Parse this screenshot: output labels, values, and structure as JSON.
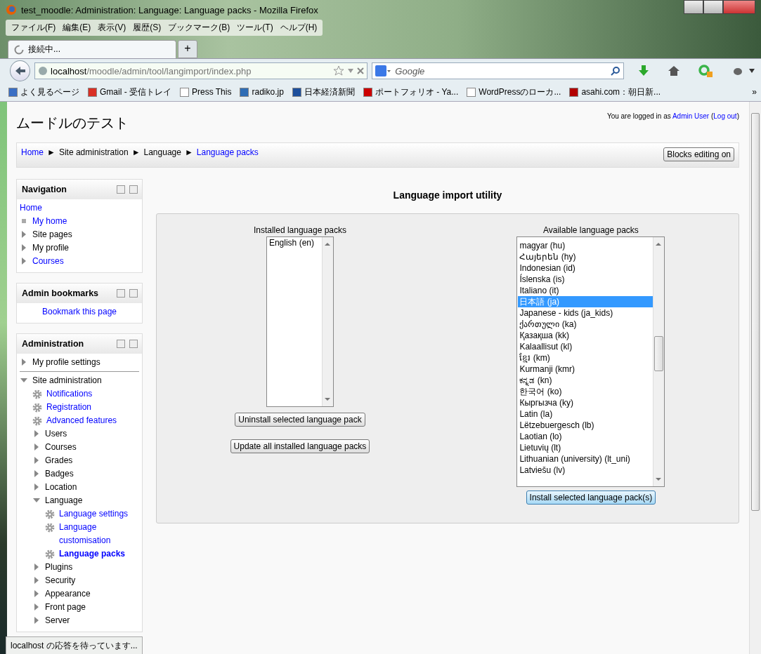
{
  "window": {
    "title": "test_moodle: Administration: Language: Language packs - Mozilla Firefox"
  },
  "menu": [
    "ファイル(F)",
    "編集(E)",
    "表示(V)",
    "履歴(S)",
    "ブックマーク(B)",
    "ツール(T)",
    "ヘルプ(H)"
  ],
  "tabs": [
    {
      "label": "接続中...",
      "selected": true,
      "loading": true
    }
  ],
  "new_tab": "+",
  "address": {
    "host": "localhost",
    "path": "/moodle/admin/tool/langimport/index.php"
  },
  "search": {
    "placeholder": "Google"
  },
  "bookmarks": [
    {
      "label": "よく見るページ",
      "color": "#3a6fc4"
    },
    {
      "label": "Gmail - 受信トレイ",
      "color": "#d93025"
    },
    {
      "label": "Press This",
      "color": "#ffffff"
    },
    {
      "label": "radiko.jp",
      "color": "#2f6db5"
    },
    {
      "label": "日本経済新聞",
      "color": "#1d4f9c"
    },
    {
      "label": "ポートフォリオ - Ya...",
      "color": "#cc0000"
    },
    {
      "label": "WordPressのローカ...",
      "color": "#ffffff"
    },
    {
      "label": "asahi.com：朝日新...",
      "color": "#b20000"
    }
  ],
  "more_bookmarks": "»",
  "site_title": "ムードルのテスト",
  "login": {
    "before": "You are logged in as",
    "user": "Admin User",
    "open": "(",
    "logout": "Log out",
    "close": ")"
  },
  "breadcrumb": [
    {
      "label": "Home",
      "link": true
    },
    {
      "sep": "►",
      "label": "Site administration",
      "link": false
    },
    {
      "sep": "►",
      "label": "Language",
      "link": false
    },
    {
      "sep": "►",
      "label": "Language packs",
      "link": true
    }
  ],
  "edit_button": "Blocks editing on",
  "blocks": [
    {
      "title": "Navigation",
      "items": [
        {
          "label": "Home",
          "kind": "plain",
          "link": true
        },
        {
          "label": "My home",
          "kind": "bullet",
          "link": true
        },
        {
          "label": "Site pages",
          "kind": "branch",
          "expanded": false,
          "link": false
        },
        {
          "label": "My profile",
          "kind": "branch",
          "expanded": false,
          "link": false
        },
        {
          "label": "Courses",
          "kind": "branch",
          "expanded": false,
          "link": true
        }
      ]
    },
    {
      "title": "Admin bookmarks",
      "items": [
        {
          "label": "Bookmark this page",
          "kind": "center",
          "link": true
        }
      ]
    },
    {
      "title": "Administration",
      "items": [
        {
          "label": "My profile settings",
          "kind": "branch",
          "expanded": false,
          "link": false,
          "divider": true
        },
        {
          "label": "Site administration",
          "kind": "branch",
          "expanded": true,
          "link": false,
          "children": [
            {
              "label": "Notifications",
              "kind": "gear",
              "link": true
            },
            {
              "label": "Registration",
              "kind": "gear",
              "link": true
            },
            {
              "label": "Advanced features",
              "kind": "gear",
              "link": true
            },
            {
              "label": "Users",
              "kind": "branch",
              "expanded": false,
              "link": false
            },
            {
              "label": "Courses",
              "kind": "branch",
              "expanded": false,
              "link": false
            },
            {
              "label": "Grades",
              "kind": "branch",
              "expanded": false,
              "link": false
            },
            {
              "label": "Badges",
              "kind": "branch",
              "expanded": false,
              "link": false
            },
            {
              "label": "Location",
              "kind": "branch",
              "expanded": false,
              "link": false
            },
            {
              "label": "Language",
              "kind": "branch",
              "expanded": true,
              "link": false,
              "children": [
                {
                  "label": "Language settings",
                  "kind": "gear",
                  "link": true,
                  "selected": false
                },
                {
                  "label": "Language customisation",
                  "kind": "gear",
                  "link": true,
                  "selected": false
                },
                {
                  "label": "Language packs",
                  "kind": "gear",
                  "link": true,
                  "selected": true
                }
              ]
            },
            {
              "label": "Plugins",
              "kind": "branch",
              "expanded": false,
              "link": false
            },
            {
              "label": "Security",
              "kind": "branch",
              "expanded": false,
              "link": false
            },
            {
              "label": "Appearance",
              "kind": "branch",
              "expanded": false,
              "link": false
            },
            {
              "label": "Front page",
              "kind": "branch",
              "expanded": false,
              "link": false
            },
            {
              "label": "Server",
              "kind": "branch",
              "expanded": false,
              "link": false
            }
          ]
        }
      ]
    }
  ],
  "main": {
    "heading": "Language import utility",
    "installed": {
      "label": "Installed language packs",
      "options": [
        {
          "label": "English (en)",
          "selected": false
        }
      ],
      "buttons": [
        "Uninstall selected language pack",
        "Update all installed language packs"
      ]
    },
    "available": {
      "label": "Available language packs",
      "options": [
        {
          "label": "magyar (hu)",
          "selected": false
        },
        {
          "label": "Հայերեն (hy)",
          "selected": false
        },
        {
          "label": "Indonesian (id)",
          "selected": false
        },
        {
          "label": "Íslenska (is)",
          "selected": false
        },
        {
          "label": "Italiano (it)",
          "selected": false
        },
        {
          "label": "日本語 (ja)",
          "selected": true
        },
        {
          "label": "Japanese - kids (ja_kids)",
          "selected": false
        },
        {
          "label": "ქართული (ka)",
          "selected": false
        },
        {
          "label": "Қазақша (kk)",
          "selected": false
        },
        {
          "label": "Kalaallisut (kl)",
          "selected": false
        },
        {
          "label": "ខ្មែរ (km)",
          "selected": false
        },
        {
          "label": "Kurmanji (kmr)",
          "selected": false
        },
        {
          "label": "ಕನ್ನಡ (kn)",
          "selected": false
        },
        {
          "label": "한국어 (ko)",
          "selected": false
        },
        {
          "label": "Кыргызча (ky)",
          "selected": false
        },
        {
          "label": "Latin (la)",
          "selected": false
        },
        {
          "label": "Lëtzebuergesch (lb)",
          "selected": false
        },
        {
          "label": "Laotian (lo)",
          "selected": false
        },
        {
          "label": "Lietuvių (lt)",
          "selected": false
        },
        {
          "label": "Lithuanian (university) (lt_uni)",
          "selected": false
        },
        {
          "label": "Latviešu (lv)",
          "selected": false
        }
      ],
      "buttons": [
        "Install selected language pack(s)"
      ]
    }
  },
  "status_bar": "localhost の応答を待っています..."
}
